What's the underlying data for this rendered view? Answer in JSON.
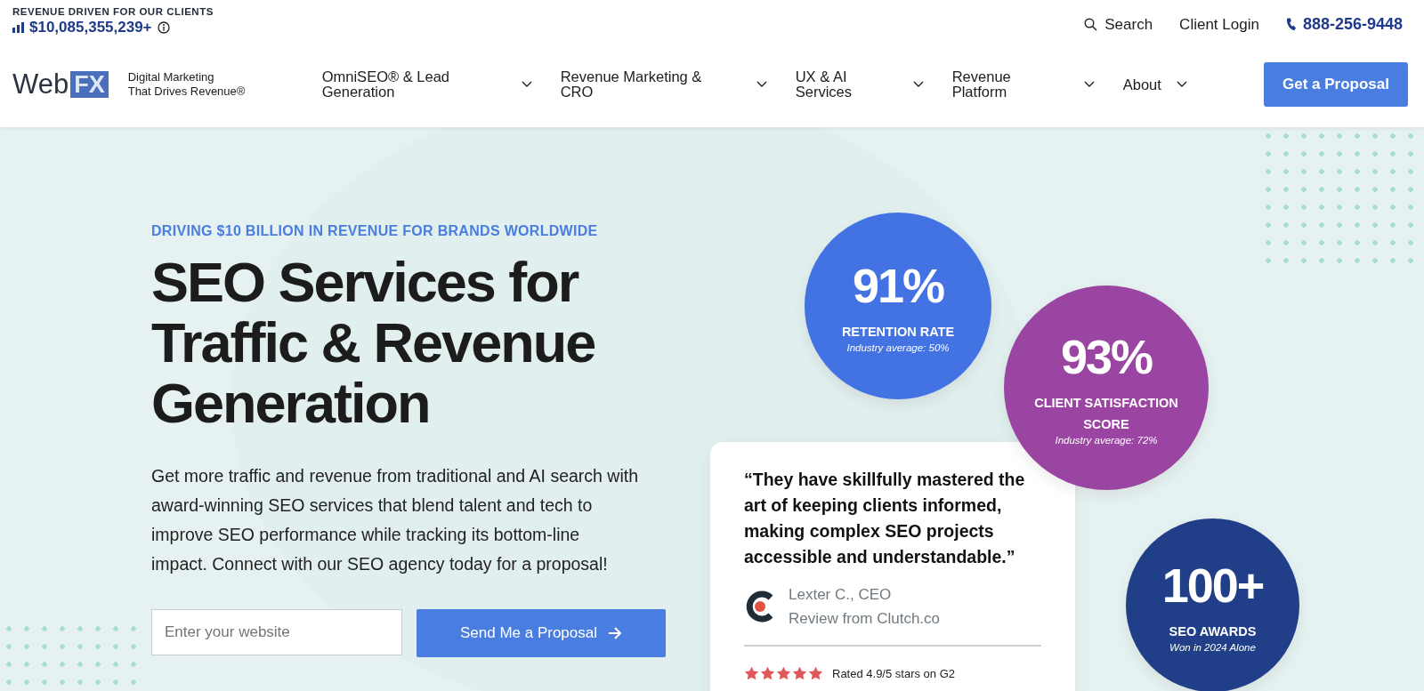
{
  "top_bar": {
    "revenue_label": "REVENUE DRIVEN FOR OUR CLIENTS",
    "revenue_value": "$10,085,355,239+",
    "search": "Search",
    "client_login": "Client Login",
    "phone": "888-256-9448"
  },
  "nav": {
    "logo_word": "Web",
    "logo_box": "FX",
    "tagline": "Digital Marketing\nThat Drives Revenue®",
    "items": [
      {
        "label": "OmniSEO® & Lead\nGeneration"
      },
      {
        "label": "Revenue Marketing &\nCRO"
      },
      {
        "label": "UX & AI\nServices"
      },
      {
        "label": "Revenue\nPlatform"
      },
      {
        "label": "About"
      }
    ],
    "cta": "Get a Proposal"
  },
  "hero": {
    "kicker": "DRIVING $10 BILLION IN REVENUE FOR BRANDS WORLDWIDE",
    "title": "SEO Services for Traffic & Revenue Generation",
    "body": "Get more traffic and revenue from traditional and AI search with award-winning SEO services that blend talent and tech to improve SEO performance while tracking its bottom-line impact. Connect with our SEO agency today for a proposal!",
    "input_placeholder": "Enter your website",
    "submit": "Send Me a Proposal"
  },
  "stats": [
    {
      "value": "91%",
      "label": "RETENTION RATE",
      "note": "Industry average: 50%",
      "color": "#4372e3"
    },
    {
      "value": "93%",
      "label": "CLIENT SATISFACTION SCORE",
      "note": "Industry average: 72%",
      "color": "#9b45a3"
    },
    {
      "value": "100+",
      "label": "SEO AWARDS",
      "note": "Won in 2024 Alone",
      "color": "#213f88"
    }
  ],
  "review": {
    "quote": "“They have skillfully mastered the art of keeping clients informed, making complex SEO projects accessible and understandable.”",
    "author": "Lexter C., CEO",
    "source": "Review from Clutch.co",
    "stars": 5,
    "rating": "Rated 4.9/5 stars on G2"
  }
}
